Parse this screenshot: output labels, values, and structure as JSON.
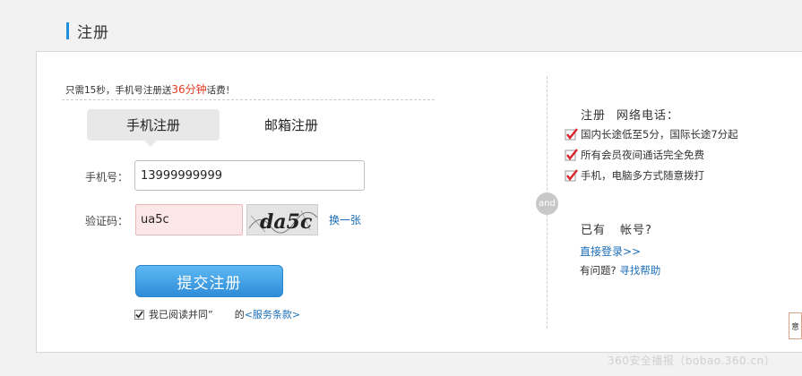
{
  "page_title": "注册",
  "promo": {
    "prefix": "只需15秒，手机号注册送",
    "highlight": "36分钟",
    "suffix": "话费！"
  },
  "tabs": {
    "phone": "手机注册",
    "email": "邮箱注册"
  },
  "form": {
    "phone_label": "手机号：",
    "phone_value": "13999999999",
    "captcha_label": "验证码：",
    "captcha_value": "ua5c",
    "captcha_image_text": "da5c",
    "change_link": "换一张",
    "submit": "提交注册",
    "agree_text": "我已阅读并同",
    "agree_mid": "”",
    "agree_tail": "的",
    "terms_link": "<服务条款>",
    "agree_checked": true
  },
  "and_badge": "and",
  "benefits": {
    "title_a": "注册",
    "title_b": "网络电话：",
    "items": [
      "国内长途低至5分，国际长途7分起",
      "所有会员夜间通话完全免费",
      "手机，电脑多方式随意拨打"
    ]
  },
  "account": {
    "title_a": "已有",
    "title_b": "帐号?",
    "login_link": "直接登录>>",
    "help_prefix": "有问题?",
    "help_link": "寻找帮助"
  },
  "right_tab": "意",
  "watermark": "360安全播报（bobao.360.cn）",
  "colors": {
    "accent": "#1e8fdc",
    "highlight": "#e53a20",
    "link": "#1a6eb8",
    "check": "#d9262c"
  }
}
